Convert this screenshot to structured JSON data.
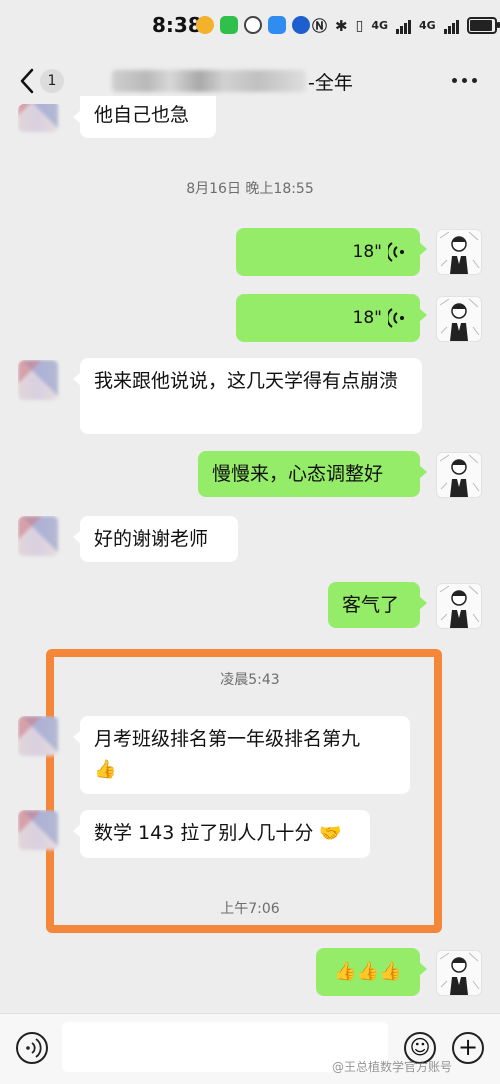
{
  "status_bar": {
    "time": "8:38",
    "network_1": "4G",
    "network_2": "4G"
  },
  "header": {
    "back_label": "1",
    "title_suffix": "-全年"
  },
  "messages": {
    "top_partial": "他自己也急",
    "ts1": "8月16日 晚上18:55",
    "voice1": "18\"",
    "voice2": "18\"",
    "m3": "我来跟他说说，这几天学得有点崩溃",
    "m4": "慢慢来，心态调整好",
    "m5": "好的谢谢老师",
    "m6": "客气了",
    "ts2": "凌晨5:43",
    "m7": "月考班级排名第一年级排名第九",
    "m8": "数学 143 拉了别人几十分",
    "ts3": "上午7:06"
  },
  "icons": {
    "thumbs": "👍",
    "handshake": "🤝",
    "smile": "☺",
    "plus": "+"
  },
  "footer": {
    "watermark": "@王总植数学官方账号"
  },
  "colors": {
    "bubble_green": "#95ec69",
    "highlight": "#f4873a",
    "bg": "#ededed"
  }
}
